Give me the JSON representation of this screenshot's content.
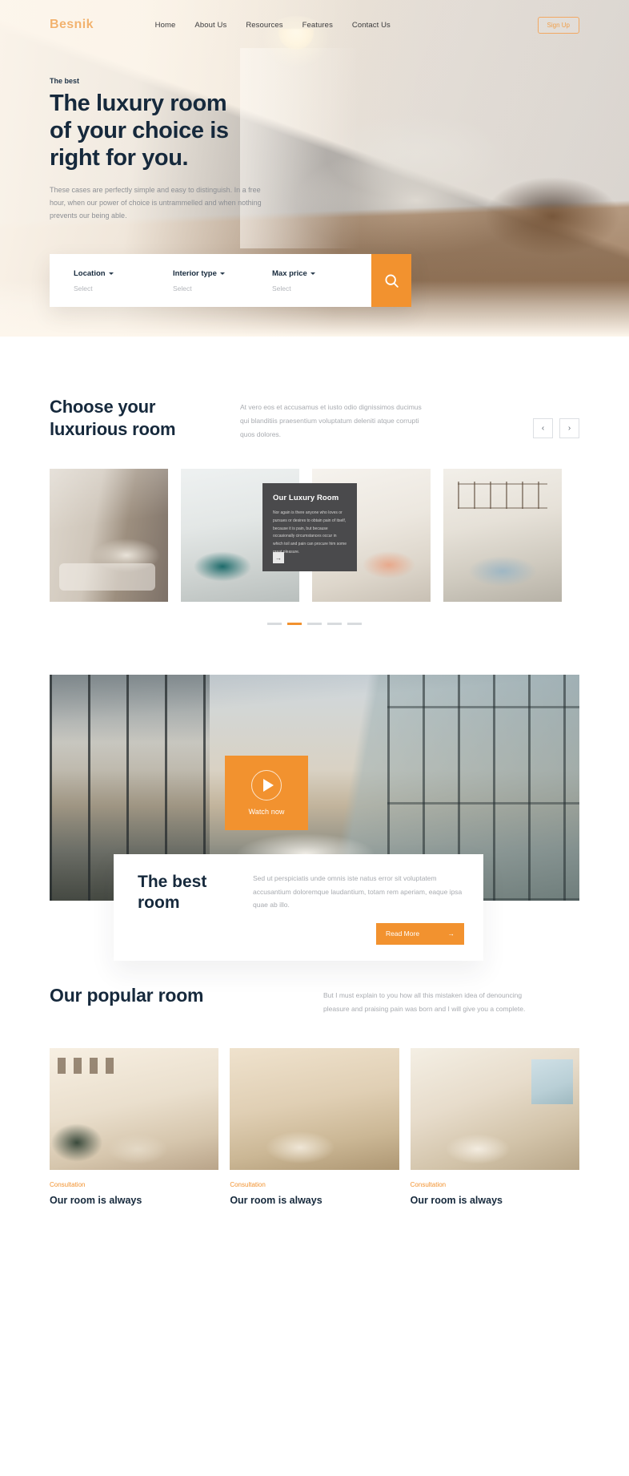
{
  "nav": {
    "logo": "Besnik",
    "links": [
      "Home",
      "About Us",
      "Resources",
      "Features",
      "Contact Us"
    ],
    "signup_label": "Sign Up"
  },
  "hero": {
    "eyebrow": "The best",
    "title_line1": "The luxury room",
    "title_line2": "of your choice is",
    "title_line3": "right for you.",
    "subtitle": "These cases are perfectly simple and easy to distinguish. In a free hour, when our power of choice is untrammelled and when nothing prevents our being able."
  },
  "search": {
    "fields": [
      {
        "label": "Location",
        "value": "Select"
      },
      {
        "label": "Interior type",
        "value": "Select"
      },
      {
        "label": "Max price",
        "value": "Select"
      }
    ],
    "submit_icon": "search-icon"
  },
  "choose": {
    "title_line1": "Choose your",
    "title_line2": "luxurious room",
    "description": "At vero eos et accusamus et iusto odio dignissimos ducimus qui blanditiis praesentium voluptatum deleniti atque corrupti quos dolores.",
    "prev_icon": "‹",
    "next_icon": "›",
    "overlay": {
      "title": "Our Luxury Room",
      "text": "Nor again is there anyone who loves or pursues or desires to obtain pain of itself, because it is pain, but because occasionally circumstances occur in which toil and pain can procure him some great pleasure.",
      "arrow_icon": "→"
    },
    "dots_count": 5,
    "active_dot": 1
  },
  "video": {
    "watch_label": "Watch now",
    "play_icon": "play-icon"
  },
  "best": {
    "title_line1": "The best",
    "title_line2": "room",
    "description": "Sed ut perspiciatis unde omnis iste natus error sit voluptatem accusantium doloremque laudantium, totam rem aperiam, eaque ipsa quae ab illo.",
    "button_label": "Read More",
    "button_arrow": "→"
  },
  "popular": {
    "title": "Our popular room",
    "description": "But I must explain to you how all this mistaken idea of denouncing pleasure and praising pain was born and I will give you a complete.",
    "cards": [
      {
        "tag": "Consultation",
        "title": "Our room is always"
      },
      {
        "tag": "Consultation",
        "title": "Our room is always"
      },
      {
        "tag": "Consultation",
        "title": "Our room is always"
      }
    ]
  }
}
